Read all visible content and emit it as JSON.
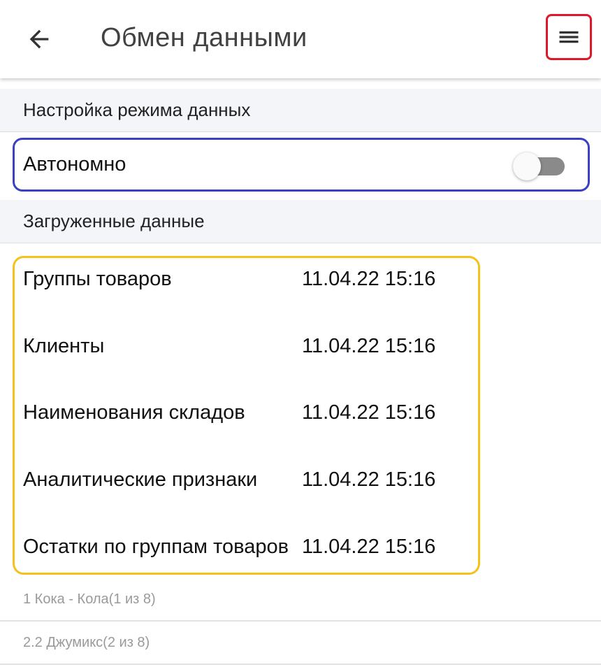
{
  "appbar": {
    "title": "Обмен данными",
    "back_icon": "arrow-left-icon",
    "menu_icon": "hamburger-menu-icon"
  },
  "settings_section": {
    "header": "Настройка режима данных",
    "autonomous": {
      "label": "Автономно",
      "enabled": false
    }
  },
  "loaded_section": {
    "header": "Загруженные данные",
    "items": [
      {
        "name": "Группы товаров",
        "date": "11.04.22 15:16"
      },
      {
        "name": "Клиенты",
        "date": "11.04.22 15:16"
      },
      {
        "name": "Наименования складов",
        "date": "11.04.22 15:16"
      },
      {
        "name": "Аналитические признаки",
        "date": "11.04.22 15:16"
      },
      {
        "name": "Остатки по группам товаров",
        "date": "11.04.22 15:16"
      }
    ]
  },
  "bottom_list": [
    {
      "label": "1 Кока - Кола(1 из 8)"
    },
    {
      "label": "2.2 Джумикс(2 из 8)"
    }
  ],
  "colors": {
    "menu_highlight": "#e0162b",
    "autonomous_highlight": "#3b3fc1",
    "data_highlight": "#f5c11a",
    "switch_track": "#8a8a8a"
  }
}
